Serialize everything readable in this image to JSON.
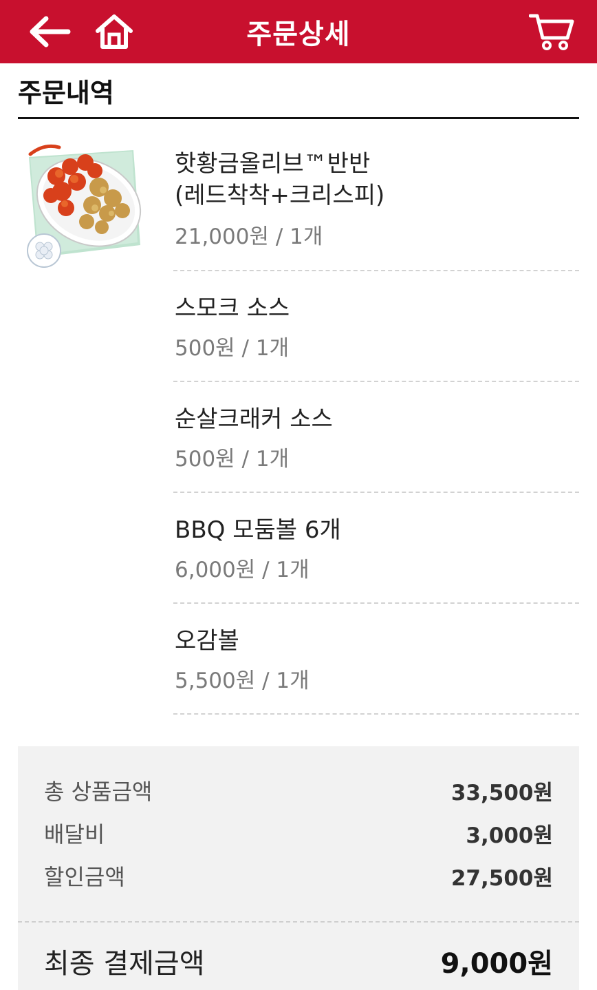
{
  "header": {
    "title": "주문상세",
    "back_icon": "arrow-left-icon",
    "home_icon": "home-icon",
    "cart_icon": "cart-icon",
    "color": "#c8102e"
  },
  "section": {
    "title": "주문내역"
  },
  "order_items": [
    {
      "name_line1": "핫황금올리브™반반",
      "name_line2": "(레드착착+크리스피)",
      "price": "21,000원 / 1개"
    },
    {
      "name_line1": "스모크 소스",
      "price": "500원 / 1개"
    },
    {
      "name_line1": "순살크래커 소스",
      "price": "500원 / 1개"
    },
    {
      "name_line1": "BBQ 모둠볼 6개",
      "price": "6,000원 / 1개"
    },
    {
      "name_line1": "오감볼",
      "price": "5,500원 / 1개"
    }
  ],
  "summary": {
    "rows": [
      {
        "label": "총 상품금액",
        "value": "33,500원"
      },
      {
        "label": "배달비",
        "value": "3,000원"
      },
      {
        "label": "할인금액",
        "value": "27,500원"
      }
    ],
    "final_label": "최종 결제금액",
    "final_value": "9,000원"
  }
}
